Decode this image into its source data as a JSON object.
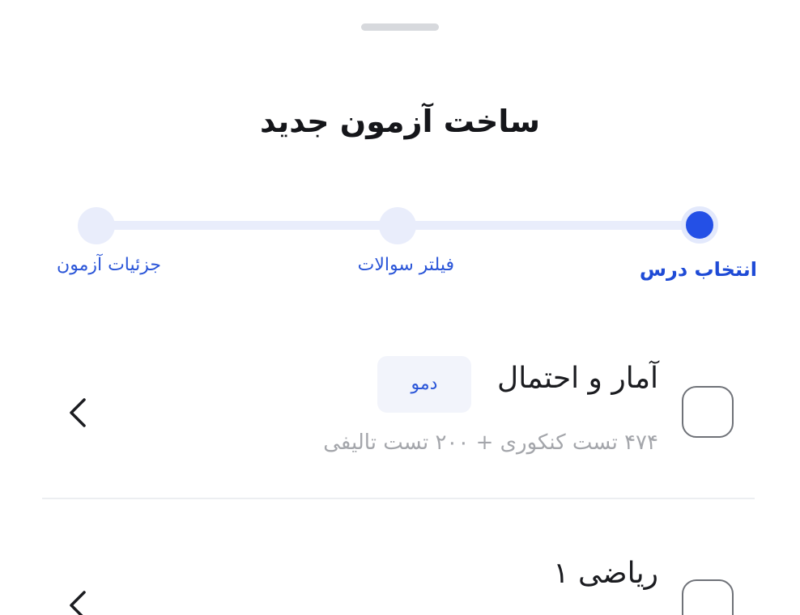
{
  "sheet": {
    "title": "ساخت آزمون جدید"
  },
  "stepper": {
    "steps": [
      {
        "label": "انتخاب درس",
        "state": "active"
      },
      {
        "label": "فیلتر سوالات",
        "state": "inactive"
      },
      {
        "label": "جزئیات آزمون",
        "state": "inactive"
      }
    ]
  },
  "courses": [
    {
      "name": "آمار و احتمال",
      "badge": "دمو",
      "subtitle": "۴۷۴ تست کنکوری + ۲۰۰ تست تالیفی",
      "checked": false,
      "icon": "chevron-left-icon"
    },
    {
      "name": "ریاضی ۱",
      "badge": "",
      "subtitle": "",
      "checked": false,
      "icon": "chevron-left-icon"
    }
  ],
  "colors": {
    "accent": "#2450e6",
    "step_track": "#e9edfb",
    "text_primary": "#15161a",
    "text_secondary": "#a4a6ab",
    "badge_bg": "#f2f4fb"
  }
}
